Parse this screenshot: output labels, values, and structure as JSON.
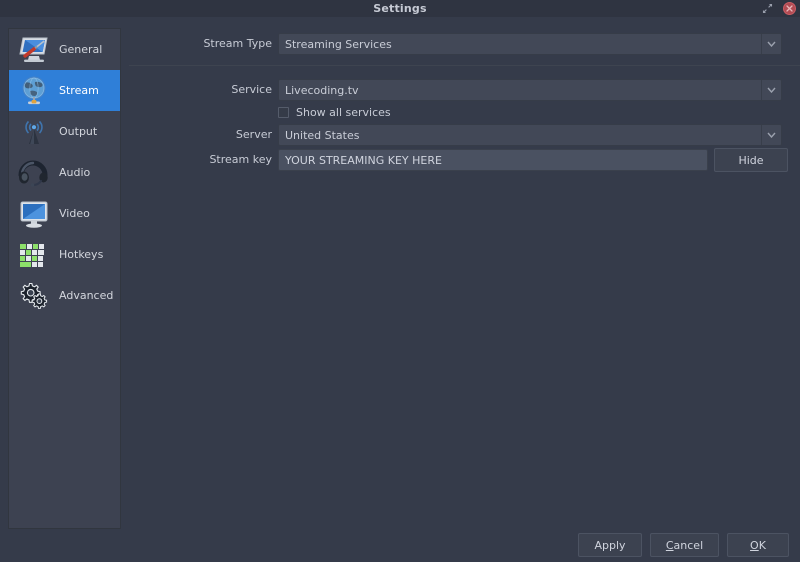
{
  "window": {
    "title": "Settings",
    "controls": [
      {
        "name": "restore-icon",
        "label": "Restore"
      },
      {
        "name": "close-icon",
        "label": "Close"
      }
    ]
  },
  "sidebar": {
    "items": [
      {
        "label": "General",
        "icon": "general-monitor-screwdriver-icon",
        "selected": false
      },
      {
        "label": "Stream",
        "icon": "stream-globe-icon",
        "selected": true
      },
      {
        "label": "Output",
        "icon": "output-broadcast-antenna-icon",
        "selected": false
      },
      {
        "label": "Audio",
        "icon": "audio-headset-icon",
        "selected": false
      },
      {
        "label": "Video",
        "icon": "video-monitor-icon",
        "selected": false
      },
      {
        "label": "Hotkeys",
        "icon": "hotkeys-keyboard-icon",
        "selected": false
      },
      {
        "label": "Advanced",
        "icon": "advanced-gears-icon",
        "selected": false
      }
    ]
  },
  "form": {
    "stream_type": {
      "label": "Stream Type",
      "value": "Streaming Services"
    },
    "service": {
      "label": "Service",
      "value": "Livecoding.tv"
    },
    "show_all_services": {
      "label": "Show all services",
      "checked": false
    },
    "server": {
      "label": "Server",
      "value": "United States"
    },
    "stream_key": {
      "label": "Stream key",
      "value": "YOUR STREAMING KEY HERE",
      "toggle_button": "Hide"
    }
  },
  "footer": {
    "apply": "Apply",
    "cancel_mnemonic": "C",
    "cancel_rest": "ancel",
    "ok_mnemonic": "O",
    "ok_rest": "K"
  },
  "colors": {
    "window_bg": "#353b4a",
    "titlebar_bg": "#2f3441",
    "panel_bg": "#3d4251",
    "selection": "#2f7fd8",
    "close_red": "#b14a52",
    "field_bg": "#424857",
    "input_bg": "#4a5161",
    "text": "#d3d6dd"
  }
}
